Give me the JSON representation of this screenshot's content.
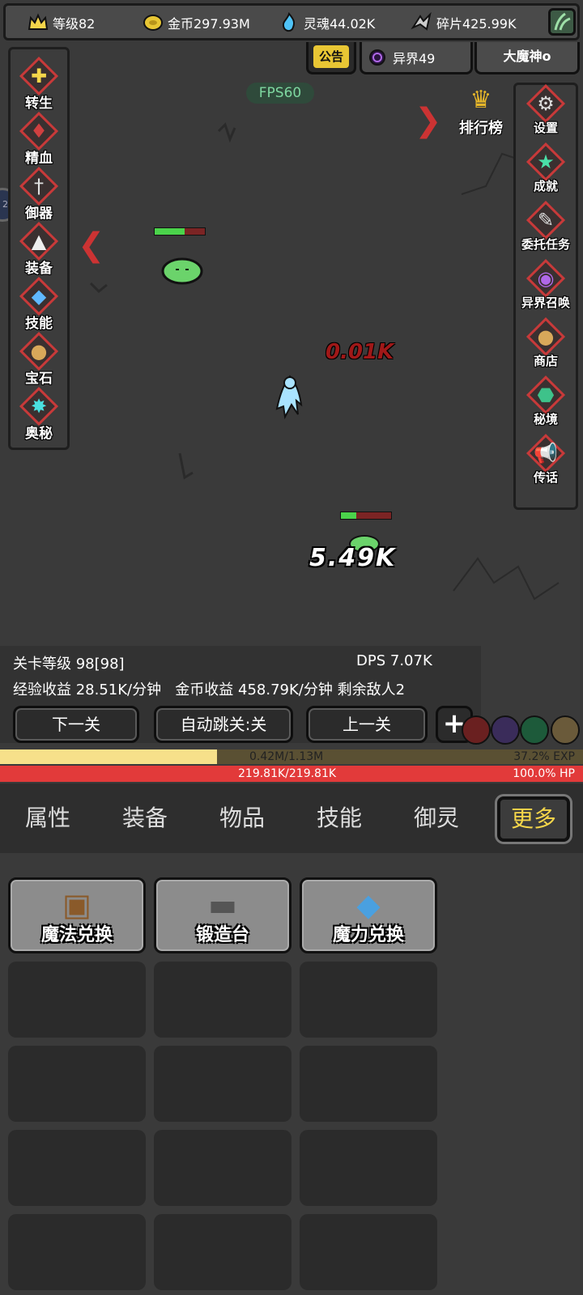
{
  "resources": [
    {
      "name": "level",
      "label": "等级82",
      "icon": "crown-icon",
      "color": "#f5d64a"
    },
    {
      "name": "gold",
      "label": "金币297.93M",
      "icon": "coin-icon",
      "color": "#e8c634"
    },
    {
      "name": "soul",
      "label": "灵魂44.02K",
      "icon": "soul-flame-icon",
      "color": "#4fc3f7"
    },
    {
      "name": "shard",
      "label": "碎片425.99K",
      "icon": "shard-icon",
      "color": "#cccccc"
    }
  ],
  "tabs": {
    "notice": "公告",
    "realm": "异界49",
    "boss": "大魔神o"
  },
  "fps": "FPS60",
  "left_menu": [
    {
      "label": "转生",
      "icon": "cross-emblem-icon"
    },
    {
      "label": "精血",
      "icon": "blood-meat-icon"
    },
    {
      "label": "御器",
      "icon": "sword-icon"
    },
    {
      "label": "装备",
      "icon": "helmet-icon"
    },
    {
      "label": "技能",
      "icon": "crystal-icon"
    },
    {
      "label": "宝石",
      "icon": "gem-bag-icon"
    },
    {
      "label": "奥秘",
      "icon": "arcane-burst-icon"
    }
  ],
  "right_menu": [
    {
      "label": "设置",
      "icon": "gear-icon"
    },
    {
      "label": "成就",
      "icon": "star-icon"
    },
    {
      "label": "委托任务",
      "icon": "scroll-icon"
    },
    {
      "label": "异界召唤",
      "icon": "portal-icon"
    },
    {
      "label": "商店",
      "icon": "pouch-icon"
    },
    {
      "label": "秘境",
      "icon": "green-stone-icon"
    },
    {
      "label": "传话",
      "icon": "megaphone-icon"
    }
  ],
  "ranking_label": "排行榜",
  "damage_numbers": {
    "red": "0.01K",
    "white": "5.49K"
  },
  "stats": {
    "stage_level": "关卡等级 98[98]",
    "dps": "DPS 7.07K",
    "income_line": "经验收益 28.51K/分钟   金币收益 458.79K/分钟 剩余敌人2"
  },
  "buttons": {
    "next": "下一关",
    "auto": "自动跳关:关",
    "prev": "上一关",
    "plus": "+"
  },
  "exp": {
    "text": "0.42M/1.13M",
    "percent": "37.2% EXP",
    "fraction": 0.372
  },
  "hp": {
    "text": "219.81K/219.81K",
    "percent": "100.0%  HP",
    "fraction": 1.0
  },
  "nav": [
    "属性",
    "装备",
    "物品",
    "技能",
    "御灵",
    "更多"
  ],
  "features": [
    {
      "label": "魔法兑换",
      "icon": "toolbox-icon"
    },
    {
      "label": "锻造台",
      "icon": "anvil-icon"
    },
    {
      "label": "魔力兑换",
      "icon": "gem-bag-icon"
    }
  ]
}
